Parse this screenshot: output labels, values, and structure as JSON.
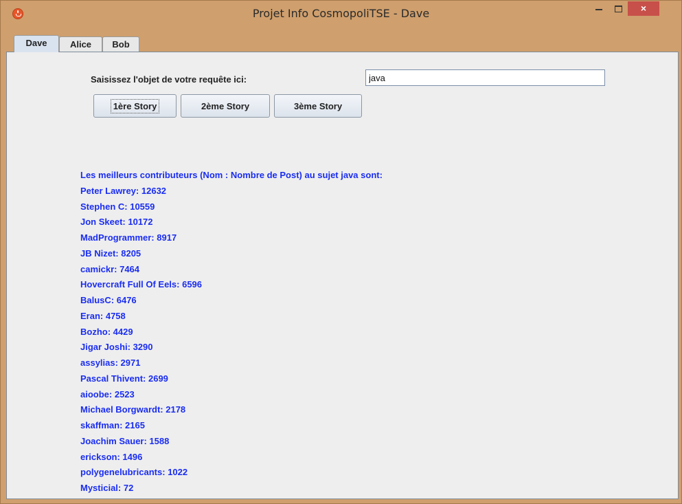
{
  "window": {
    "title": "Projet Info CosmopoliTSE - Dave",
    "close_label": "×"
  },
  "tabs": [
    {
      "label": "Dave",
      "selected": true
    },
    {
      "label": "Alice",
      "selected": false
    },
    {
      "label": "Bob",
      "selected": false
    }
  ],
  "query": {
    "label": "Saisissez l'objet de votre requête ici:",
    "value": "java"
  },
  "buttons": {
    "story1": "1ère Story",
    "story2": "2ème Story",
    "story3": "3ème Story"
  },
  "results": {
    "header": "Les meilleurs contributeurs (Nom : Nombre de Post) au sujet java sont:",
    "items": [
      "Peter Lawrey: 12632",
      "Stephen C: 10559",
      "Jon Skeet: 10172",
      "MadProgrammer: 8917",
      "JB Nizet: 8205",
      "camickr: 7464",
      "Hovercraft Full Of Eels: 6596",
      "BalusC: 6476",
      "Eran: 4758",
      "Bozho: 4429",
      "Jigar Joshi: 3290",
      "assylias: 2971",
      "Pascal Thivent: 2699",
      "aioobe: 2523",
      "Michael Borgwardt: 2178",
      "skaffman: 2165",
      "Joachim Sauer: 1588",
      "erickson: 1496",
      "polygenelubricants: 1022",
      "Mysticial: 72"
    ]
  },
  "colors": {
    "title_bar": "#cf9f6d",
    "close_button": "#c7504a",
    "result_text": "#1a2df0",
    "panel_bg": "#eeeeee"
  },
  "icons": {
    "app": "java-cup-icon",
    "minimize": "minimize-icon",
    "maximize": "maximize-icon",
    "close": "close-icon"
  }
}
